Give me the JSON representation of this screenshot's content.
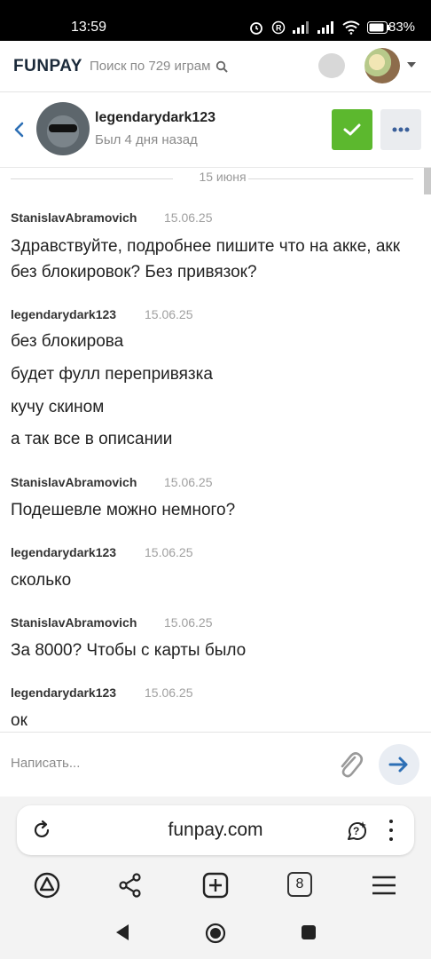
{
  "status_bar": {
    "time": "13:59",
    "battery": "83%"
  },
  "header": {
    "logo": "FUNPAY",
    "search_placeholder": "Поиск по 729 играм"
  },
  "chat": {
    "username": "legendarydark123",
    "last_seen": "Был 4 дня назад",
    "date_separator": "15 июня",
    "messages": [
      {
        "author": "StanislavAbramovich",
        "time": "15.06.25",
        "lines": [
          "Здравствуйте, подробнее пишите что на акке, акк без блокировок? Без привязок?"
        ]
      },
      {
        "author": "legendarydark123",
        "time": "15.06.25",
        "lines": [
          "без блокирова",
          "будет фулл перепривязка",
          "кучу скином",
          "а так все в описании"
        ]
      },
      {
        "author": "StanislavAbramovich",
        "time": "15.06.25",
        "lines": [
          "Подешевле можно немного?"
        ]
      },
      {
        "author": "legendarydark123",
        "time": "15.06.25",
        "lines": [
          "сколько"
        ]
      },
      {
        "author": "StanislavAbramovich",
        "time": "15.06.25",
        "lines": [
          "За 8000? Чтобы с карты было"
        ]
      },
      {
        "author": "legendarydark123",
        "time": "15.06.25",
        "lines": [
          "ок"
        ]
      }
    ]
  },
  "composer": {
    "placeholder": "Написать..."
  },
  "browser": {
    "url": "funpay.com",
    "tabs_count": "8"
  }
}
